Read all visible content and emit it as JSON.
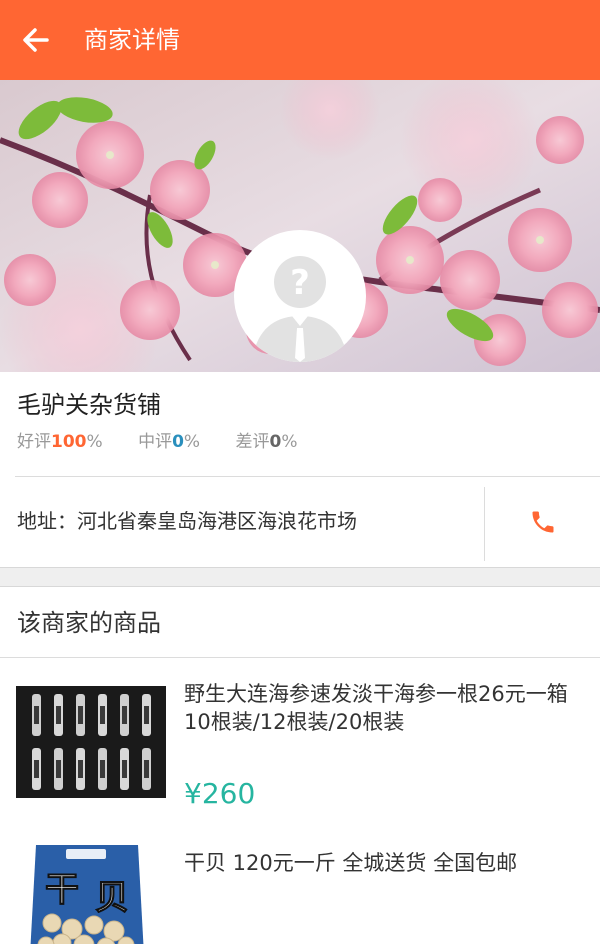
{
  "header": {
    "title": "商家详情",
    "background_color": "#ff6633",
    "back_icon": "arrow-left-icon"
  },
  "banner": {
    "background": "pink-cherry-blossom-photo",
    "avatar_icon": "placeholder-user-question-icon"
  },
  "shop": {
    "name": "毛驴关杂货铺",
    "ratings": [
      {
        "label": "好评",
        "value": "100",
        "unit": "%",
        "color": "#ff6633"
      },
      {
        "label": "中评",
        "value": "0",
        "unit": "%",
        "color": "#2a8fbd"
      },
      {
        "label": "差评",
        "value": "0",
        "unit": "%",
        "color": "#666666"
      }
    ],
    "address_label": "地址：",
    "address": "河北省秦皇岛海港区海浪花市场",
    "phone_icon": "phone-icon",
    "phone_color": "#ff6633"
  },
  "products_section": {
    "title": "该商家的商品",
    "items": [
      {
        "title": "野生大连海参速发淡干海参一根26元一箱10根装/12根装/20根装",
        "price": "¥260",
        "image": "sea-cucumber-box-photo"
      },
      {
        "title": "干贝 120元一斤 全城送货 全国包邮",
        "image": "dried-scallop-bag-photo"
      }
    ],
    "price_color": "#26b5a0"
  }
}
